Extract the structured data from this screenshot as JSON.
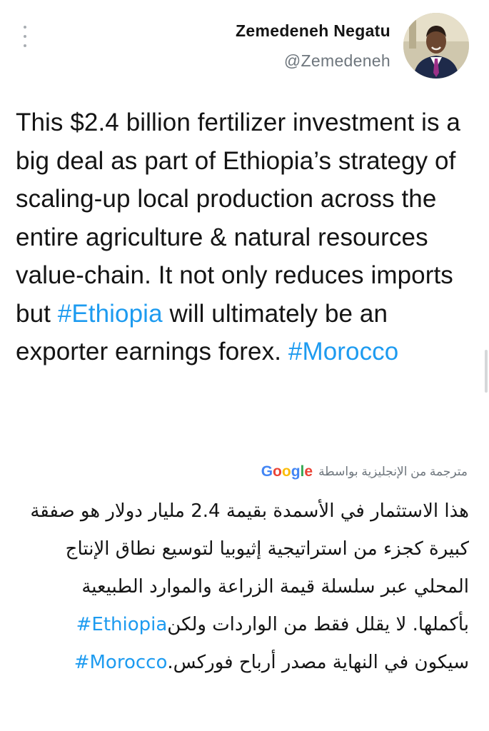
{
  "user": {
    "display_name": "Zemedeneh Negatu",
    "handle": "@Zemedeneh"
  },
  "tweet": {
    "text_part1": "This $2.4 billion fertilizer investment is a big deal as part of Ethiopia’s strategy of scaling-up local production across the entire agriculture & natural resources value-chain. It not only reduces imports but ",
    "hashtag1": "#Ethiopia",
    "text_part2": " will ultimately be an exporter earnings forex. ",
    "hashtag2": "#Morocco"
  },
  "translation": {
    "label": "مترجمة من الإنجليزية بواسطة",
    "provider": "Google",
    "text_part1": "هذا الاستثمار في الأسمدة بقيمة 2.4 مليار دولار هو صفقة كبيرة كجزء من استراتيجية إثيوبيا لتوسيع نطاق الإنتاج المحلي عبر سلسلة قيمة الزراعة والموارد الطبيعية بأكملها. لا يقلل فقط من الواردات ولكن",
    "hashtag1": "#Ethiopia",
    "text_part2": " سيكون في النهاية مصدر أرباح فوركس.",
    "hashtag2": "#Morocco"
  },
  "icons": {
    "more": "more-vertical-icon",
    "avatar": "profile-photo"
  },
  "colors": {
    "hashtag": "#1d9bf0",
    "secondary_text": "#6e767d",
    "primary_text": "#141414"
  }
}
